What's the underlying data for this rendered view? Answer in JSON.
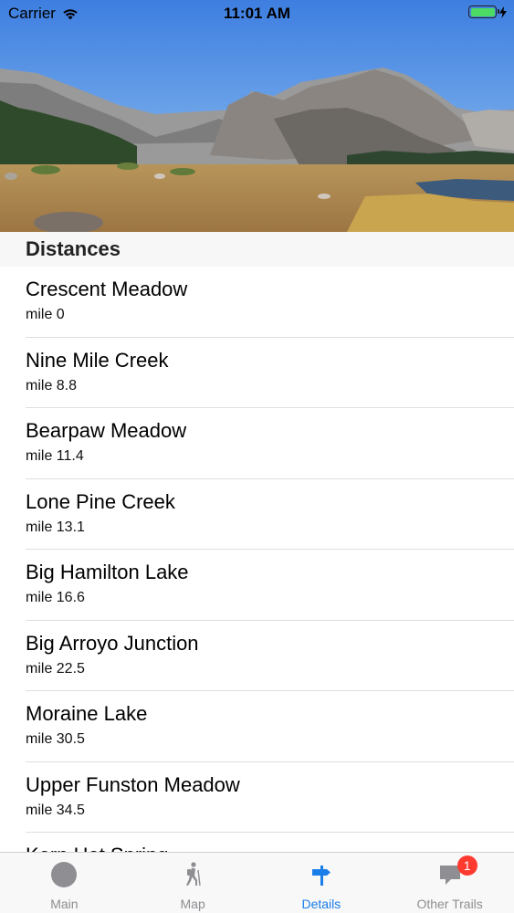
{
  "status_bar": {
    "carrier": "Carrier",
    "time": "11:01 AM"
  },
  "section": {
    "title": "Distances"
  },
  "waypoints": [
    {
      "name": "Crescent Meadow",
      "mile": "mile 0"
    },
    {
      "name": "Nine Mile Creek",
      "mile": "mile 8.8"
    },
    {
      "name": "Bearpaw Meadow",
      "mile": "mile 11.4"
    },
    {
      "name": "Lone Pine Creek",
      "mile": "mile 13.1"
    },
    {
      "name": "Big Hamilton Lake",
      "mile": "mile 16.6"
    },
    {
      "name": "Big Arroyo Junction",
      "mile": "mile 22.5"
    },
    {
      "name": "Moraine Lake",
      "mile": "mile 30.5"
    },
    {
      "name": "Upper Funston Meadow",
      "mile": "mile 34.5"
    },
    {
      "name": "Kern Hot Spring",
      "mile": ""
    }
  ],
  "tab_bar": {
    "tabs": [
      {
        "label": "Main",
        "icon": "circle-icon"
      },
      {
        "label": "Map",
        "icon": "hiker-icon"
      },
      {
        "label": "Details",
        "icon": "signpost-icon"
      },
      {
        "label": "Other Trails",
        "icon": "chat-bubble-icon",
        "badge": "1"
      }
    ],
    "active_color": "#1a7ee8",
    "inactive_color": "#8e8e93"
  }
}
